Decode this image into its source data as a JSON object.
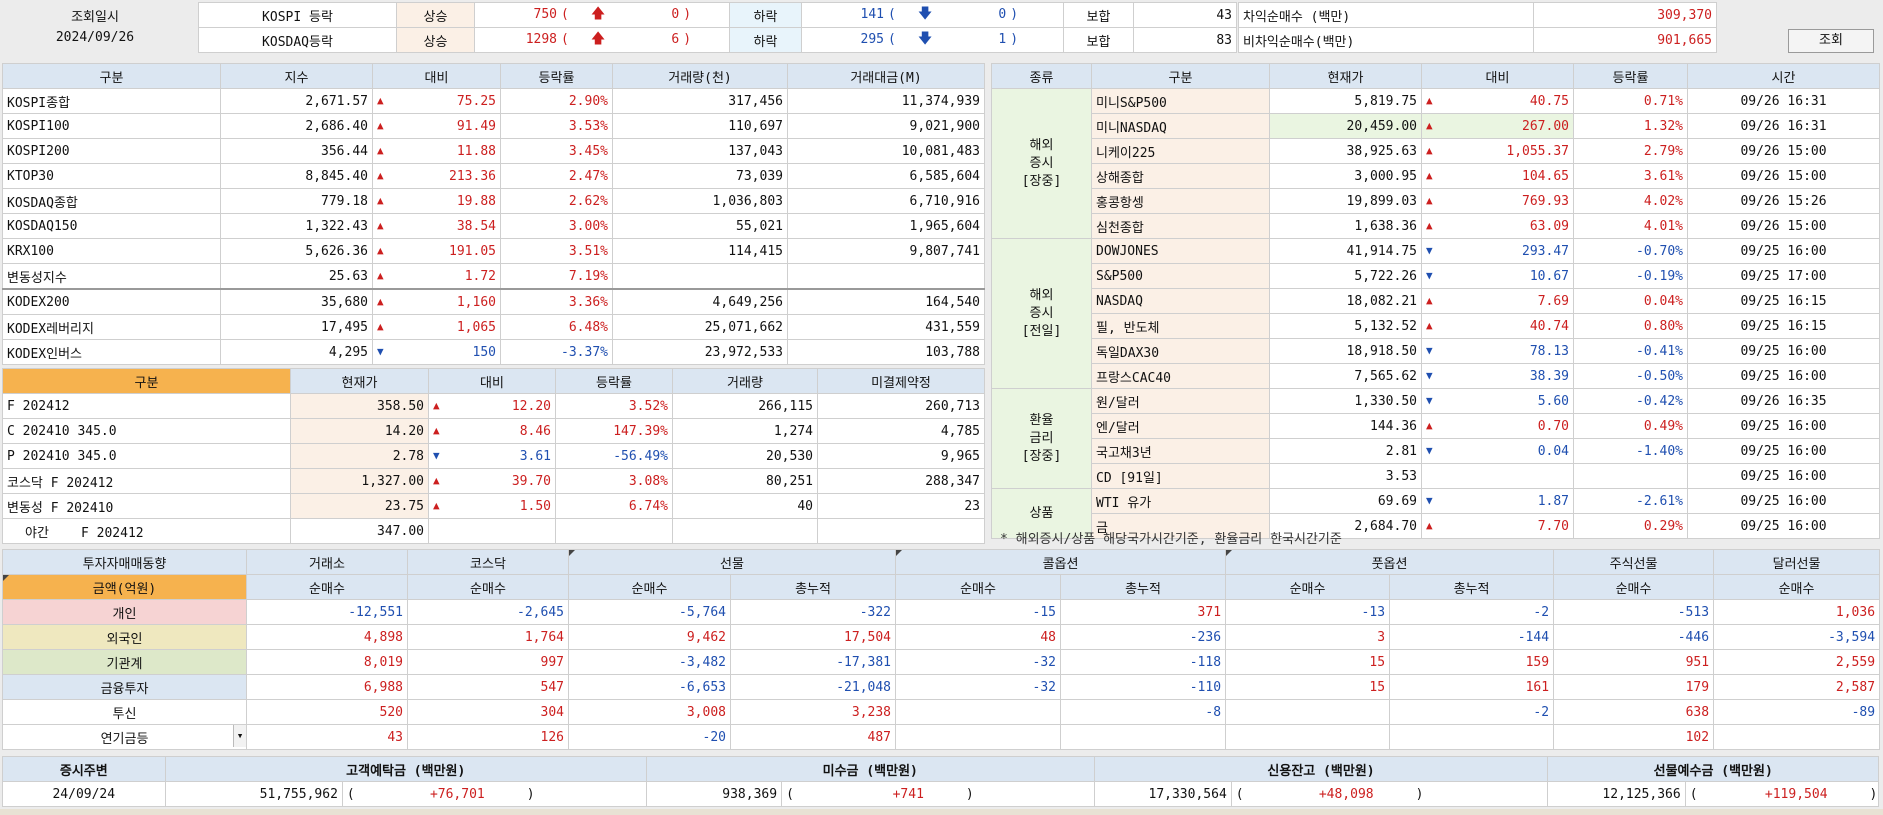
{
  "header": {
    "query_label": "조회일시",
    "date": "2024/09/26",
    "button": "조회",
    "rows": [
      {
        "market": "KOSPI 등락",
        "up_label": "상승",
        "up": "750",
        "upper": "0",
        "down_label": "하락",
        "down": "141",
        "lower": "0",
        "flat_label": "보합",
        "flat": "43"
      },
      {
        "market": "KOSDAQ등락",
        "up_label": "상승",
        "up": "1298",
        "upper": "6",
        "down_label": "하락",
        "down": "295",
        "lower": "1",
        "flat_label": "보합",
        "flat": "83"
      }
    ],
    "arb": [
      {
        "label": "차익순매수 (백만)",
        "value": "309,370"
      },
      {
        "label": "비차익순매수(백만)",
        "value": "901,665"
      }
    ],
    "paren_open": "(",
    "paren_close": ")"
  },
  "index_table": {
    "headers": [
      "구분",
      "지수",
      "대비",
      "등락률",
      "거래량(천)",
      "거래대금(M)"
    ],
    "rows": [
      [
        "KOSPI종합",
        "2,671.57",
        "up",
        "75.25",
        "2.90%",
        "317,456",
        "11,374,939"
      ],
      [
        "KOSPI100",
        "2,686.40",
        "up",
        "91.49",
        "3.53%",
        "110,697",
        "9,021,900"
      ],
      [
        "KOSPI200",
        "356.44",
        "up",
        "11.88",
        "3.45%",
        "137,043",
        "10,081,483"
      ],
      [
        "KTOP30",
        "8,845.40",
        "up",
        "213.36",
        "2.47%",
        "73,039",
        "6,585,604"
      ],
      [
        "KOSDAQ종합",
        "779.18",
        "up",
        "19.88",
        "2.62%",
        "1,036,803",
        "6,710,916"
      ],
      [
        "KOSDAQ150",
        "1,322.43",
        "up",
        "38.54",
        "3.00%",
        "55,021",
        "1,965,604"
      ],
      [
        "KRX100",
        "5,626.36",
        "up",
        "191.05",
        "3.51%",
        "114,415",
        "9,807,741"
      ],
      [
        "변동성지수",
        "25.63",
        "up",
        "1.72",
        "7.19%",
        "",
        ""
      ],
      [
        "KODEX200",
        "35,680",
        "up",
        "1,160",
        "3.36%",
        "4,649,256",
        "164,540"
      ],
      [
        "KODEX레버리지",
        "17,495",
        "up",
        "1,065",
        "6.48%",
        "25,071,662",
        "431,559"
      ],
      [
        "KODEX인버스",
        "4,295",
        "dn",
        "150",
        "-3.37%",
        "23,972,533",
        "103,788"
      ]
    ]
  },
  "futures_table": {
    "headers": [
      "구분",
      "현재가",
      "대비",
      "등락률",
      "거래량",
      "미결제약정"
    ],
    "rows": [
      [
        "F 202412",
        "358.50",
        "up",
        "12.20",
        "3.52%",
        "266,115",
        "260,713"
      ],
      [
        "C 202410 345.0",
        "14.20",
        "up",
        "8.46",
        "147.39%",
        "1,274",
        "4,785"
      ],
      [
        "P 202410 345.0",
        "2.78",
        "dn",
        "3.61",
        "-56.49%",
        "20,530",
        "9,965"
      ],
      [
        "코스닥 F 202412",
        "1,327.00",
        "up",
        "39.70",
        "3.08%",
        "80,251",
        "288,347"
      ],
      [
        "변동성 F 202410",
        "23.75",
        "up",
        "1.50",
        "6.74%",
        "40",
        "23"
      ]
    ],
    "night": {
      "label": "야간",
      "name": "F 202412",
      "price": "347.00"
    }
  },
  "global_table": {
    "headers": [
      "종류",
      "구분",
      "현재가",
      "대비",
      "등락률",
      "시간"
    ],
    "groups": [
      {
        "label": "해외\n증시\n[장중]",
        "rows": [
          [
            "미니S&P500",
            "5,819.75",
            "up",
            "40.75",
            "0.71%",
            "09/26 16:31"
          ],
          [
            "미니NASDAQ",
            "20,459.00",
            "up",
            "267.00",
            "1.32%",
            "09/26 16:31"
          ],
          [
            "니케이225",
            "38,925.63",
            "up",
            "1,055.37",
            "2.79%",
            "09/26 15:00"
          ],
          [
            "상해종합",
            "3,000.95",
            "up",
            "104.65",
            "3.61%",
            "09/26 15:00"
          ],
          [
            "홍콩항셍",
            "19,899.03",
            "up",
            "769.93",
            "4.02%",
            "09/26 15:26"
          ],
          [
            "심천종합",
            "1,638.36",
            "up",
            "63.09",
            "4.01%",
            "09/26 15:00"
          ]
        ]
      },
      {
        "label": "해외\n증시\n[전일]",
        "rows": [
          [
            "DOWJONES",
            "41,914.75",
            "dn",
            "293.47",
            "-0.70%",
            "09/25 16:00"
          ],
          [
            "S&P500",
            "5,722.26",
            "dn",
            "10.67",
            "-0.19%",
            "09/25 17:00"
          ],
          [
            "NASDAQ",
            "18,082.21",
            "up",
            "7.69",
            "0.04%",
            "09/25 16:15"
          ],
          [
            "필, 반도체",
            "5,132.52",
            "up",
            "40.74",
            "0.80%",
            "09/25 16:15"
          ],
          [
            "독일DAX30",
            "18,918.50",
            "dn",
            "78.13",
            "-0.41%",
            "09/25 16:00"
          ],
          [
            "프랑스CAC40",
            "7,565.62",
            "dn",
            "38.39",
            "-0.50%",
            "09/25 16:00"
          ]
        ]
      },
      {
        "label": "환율\n금리\n[장중]",
        "rows": [
          [
            "원/달러",
            "1,330.50",
            "dn",
            "5.60",
            "-0.42%",
            "09/26 16:35"
          ],
          [
            "엔/달러",
            "144.36",
            "up",
            "0.70",
            "0.49%",
            "09/25 16:00"
          ],
          [
            "국고채3년",
            "2.81",
            "dn",
            "0.04",
            "-1.40%",
            "09/25 16:00"
          ],
          [
            "CD [91일]",
            "3.53",
            "",
            "",
            "",
            "09/25 16:00"
          ]
        ]
      },
      {
        "label": "상품",
        "rows": [
          [
            "WTI 유가",
            "69.69",
            "dn",
            "1.87",
            "-2.61%",
            "09/25 16:00"
          ],
          [
            "금",
            "2,684.70",
            "up",
            "7.70",
            "0.29%",
            "09/25 16:00"
          ]
        ]
      }
    ],
    "note": "* 해외증시/상품 해당국가시간기준, 환율금리 한국시간기준"
  },
  "investor_table": {
    "title": "투자자매매동향",
    "unit": "금액(억원)",
    "cols": [
      "거래소",
      "코스닥",
      "선물",
      "콜옵션",
      "풋옵션",
      "주식선물",
      "달러선물"
    ],
    "sub": [
      "순매수",
      "순매수",
      "순매수",
      "총누적",
      "순매수",
      "총누적",
      "순매수",
      "총누적",
      "순매수",
      "순매수"
    ],
    "rows": [
      {
        "name": "개인",
        "vals": [
          "-12,551",
          "-2,645",
          "-5,764",
          "-322",
          "-15",
          "371",
          "-13",
          "-2",
          "-513",
          "1,036"
        ]
      },
      {
        "name": "외국인",
        "vals": [
          "4,898",
          "1,764",
          "9,462",
          "17,504",
          "48",
          "-236",
          "3",
          "-144",
          "-446",
          "-3,594"
        ]
      },
      {
        "name": "기관계",
        "vals": [
          "8,019",
          "997",
          "-3,482",
          "-17,381",
          "-32",
          "-118",
          "15",
          "159",
          "951",
          "2,559"
        ]
      },
      {
        "name": "금융투자",
        "vals": [
          "6,988",
          "547",
          "-6,653",
          "-21,048",
          "-32",
          "-110",
          "15",
          "161",
          "179",
          "2,587"
        ]
      },
      {
        "name": "투신",
        "vals": [
          "520",
          "304",
          "3,008",
          "3,238",
          "",
          "-8",
          "",
          "-2",
          "638",
          "-89"
        ]
      },
      {
        "name": "연기금등",
        "vals": [
          "43",
          "126",
          "-20",
          "487",
          "",
          "",
          "",
          "",
          "102",
          ""
        ]
      }
    ]
  },
  "funds_table": {
    "headers": [
      "증시주변",
      "고객예탁금 (백만원)",
      "미수금 (백만원)",
      "신용잔고 (백만원)",
      "선물예수금 (백만원)"
    ],
    "date": "24/09/24",
    "vals": [
      {
        "v": "51,755,962",
        "d": "+76,701"
      },
      {
        "v": "938,369",
        "d": "+741"
      },
      {
        "v": "17,330,564",
        "d": "+48,098"
      },
      {
        "v": "12,125,366",
        "d": "+119,504"
      }
    ]
  },
  "colors": {
    "up": "#cc1f1f",
    "down": "#1f4fb0",
    "header_bg": "#dbe6f2",
    "accent": "#f6b24e"
  }
}
